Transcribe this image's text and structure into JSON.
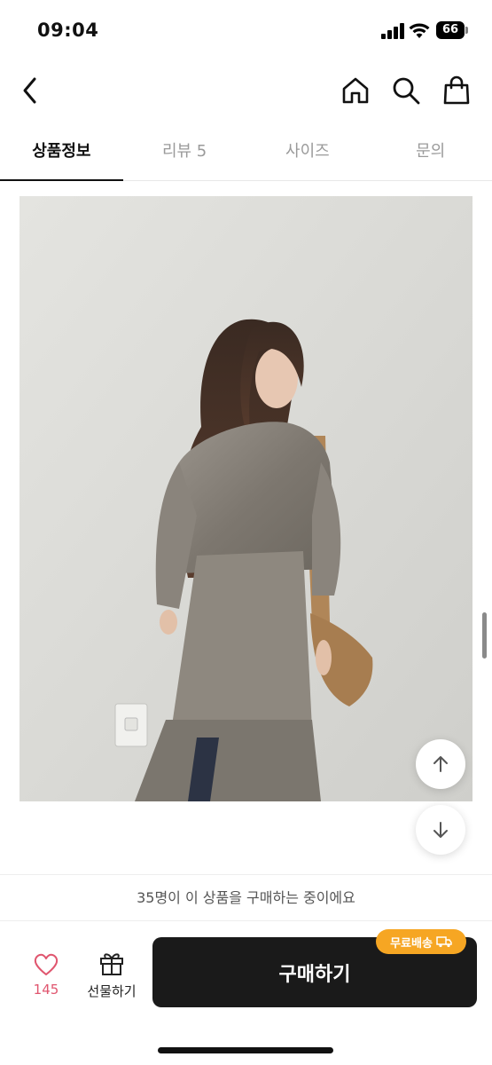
{
  "status_bar": {
    "time": "09:04",
    "battery": "66"
  },
  "nav": {
    "icons": [
      "back-chevron-icon",
      "home-icon",
      "search-icon",
      "shopping-bag-icon"
    ]
  },
  "tabs": [
    {
      "label": "상품정보",
      "active": true
    },
    {
      "label": "리뷰 5",
      "active": false
    },
    {
      "label": "사이즈",
      "active": false
    },
    {
      "label": "문의",
      "active": false
    }
  ],
  "product": {
    "image_icon": "product-photo"
  },
  "notice": {
    "buying_now": "35명이 이 상품을 구매하는 중이에요"
  },
  "actions": {
    "like_count": "145",
    "gift_label": "선물하기",
    "buy_label": "구매하기",
    "free_shipping_badge": "무료배송"
  },
  "colors": {
    "accent_badge": "#f6a623",
    "like_pink": "#e0566f",
    "buy_button": "#1a1a1a"
  }
}
